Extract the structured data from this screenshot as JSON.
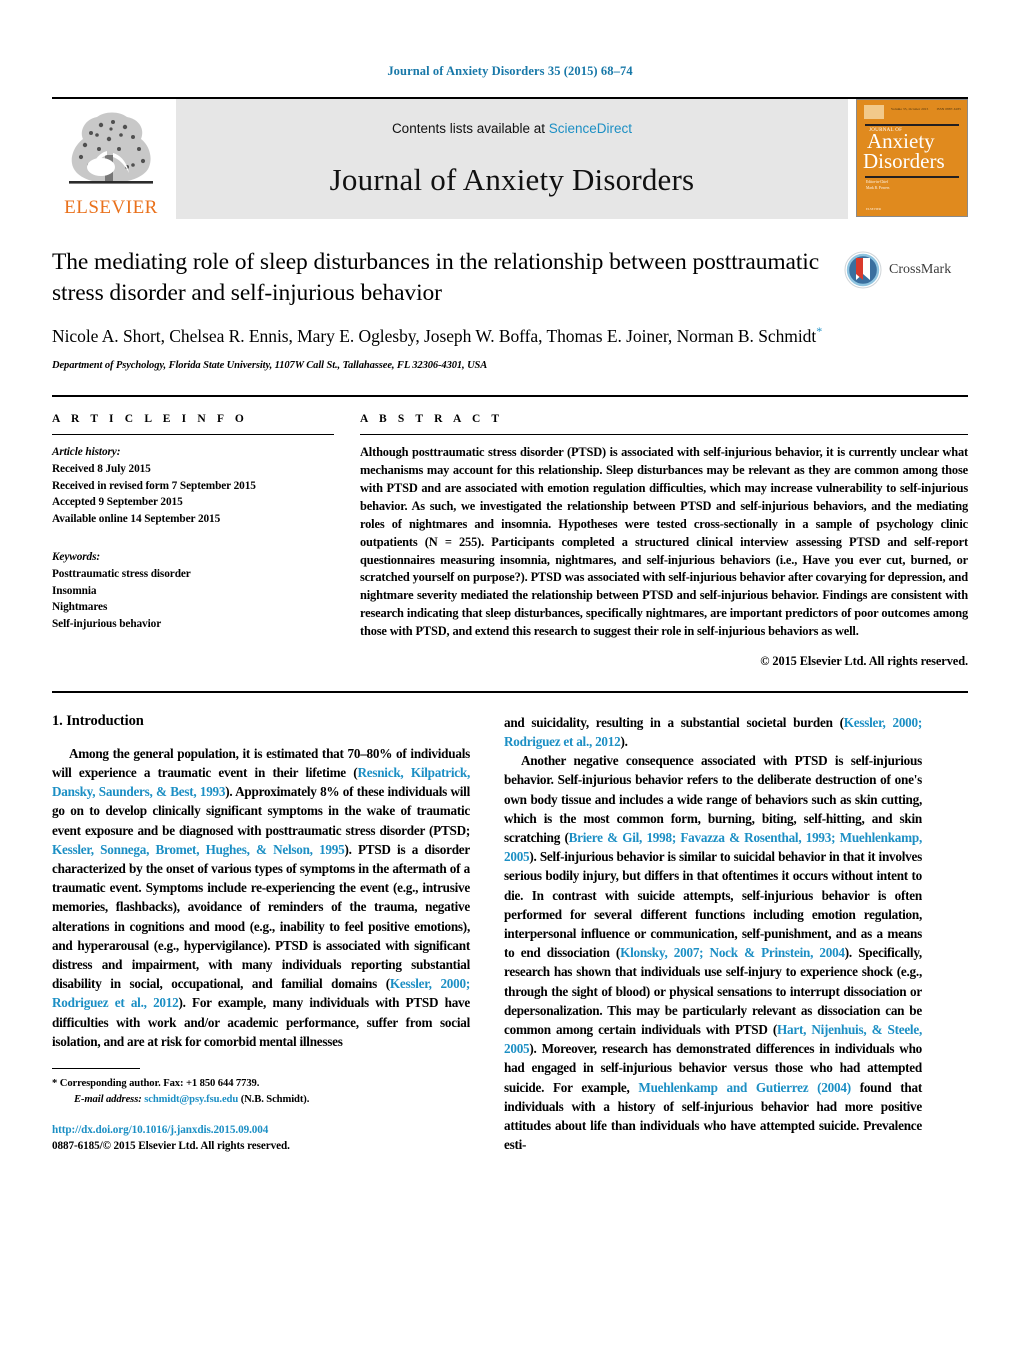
{
  "running_head": "Journal of Anxiety Disorders 35 (2015) 68–74",
  "masthead": {
    "elsevier_wordmark": "ELSEVIER",
    "contents_prefix": "Contents lists available at ",
    "sciencedirect": "ScienceDirect",
    "journal_name": "Journal of Anxiety Disorders",
    "cover": {
      "journal_of": "JOURNAL OF",
      "line1": "Anxiety",
      "line2": "Disorders",
      "editor_label": "Editor-in-Chief",
      "editor_name": "Mark B. Powers",
      "publisher": "ELSEVIER",
      "top_left": "ISSN",
      "top_mid": "Volume 35, October 2015",
      "top_right": "ISSN 0887-6185"
    },
    "link_color": "#1c8fc4",
    "cover_color": "#E08A1E",
    "elsevier_color": "#E9711C"
  },
  "title": "The mediating role of sleep disturbances in the relationship between posttraumatic stress disorder and self-injurious behavior",
  "authors": "Nicole A. Short, Chelsea R. Ennis, Mary E. Oglesby, Joseph W. Boffa, Thomas E. Joiner, Norman B. Schmidt",
  "corresponding_marker": "*",
  "affiliation": "Department of Psychology, Florida State University, 1107W Call St., Tallahassee, FL 32306-4301, USA",
  "crossmark": {
    "label": "CrossMark"
  },
  "article_info": {
    "heading": "A R T I C L E  I N F O",
    "history_label": "Article history:",
    "history": [
      "Received 8 July 2015",
      "Received in revised form 7 September 2015",
      "Accepted 9 September 2015",
      "Available online 14 September 2015"
    ],
    "keywords_label": "Keywords:",
    "keywords": [
      "Posttraumatic stress disorder",
      "Insomnia",
      "Nightmares",
      "Self-injurious behavior"
    ]
  },
  "abstract": {
    "heading": "A B S T R A C T",
    "text": "Although posttraumatic stress disorder (PTSD) is associated with self-injurious behavior, it is currently unclear what mechanisms may account for this relationship. Sleep disturbances may be relevant as they are common among those with PTSD and are associated with emotion regulation difficulties, which may increase vulnerability to self-injurious behavior. As such, we investigated the relationship between PTSD and self-injurious behaviors, and the mediating roles of nightmares and insomnia. Hypotheses were tested cross-sectionally in a sample of psychology clinic outpatients (N = 255). Participants completed a structured clinical interview assessing PTSD and self-report questionnaires measuring insomnia, nightmares, and self-injurious behaviors (i.e., Have you ever cut, burned, or scratched yourself on purpose?). PTSD was associated with self-injurious behavior after covarying for depression, and nightmare severity mediated the relationship between PTSD and self-injurious behavior. Findings are consistent with research indicating that sleep disturbances, specifically nightmares, are important predictors of poor outcomes among those with PTSD, and extend this research to suggest their role in self-injurious behaviors as well.",
    "copyright": "© 2015 Elsevier Ltd. All rights reserved."
  },
  "body": {
    "section_number_title": "1. Introduction",
    "left_paragraph_1": {
      "seg1": "Among the general population, it is estimated that 70–80% of individuals will experience a traumatic event in their lifetime (",
      "cite1": "Resnick, Kilpatrick, Dansky, Saunders, & Best, 1993",
      "seg2": "). Approximately 8% of these individuals will go on to develop clinically significant symptoms in the wake of traumatic event exposure and be diagnosed with posttraumatic stress disorder (PTSD; ",
      "cite2": "Kessler, Sonnega, Bromet, Hughes, & Nelson, 1995",
      "seg3": "). PTSD is a disorder characterized by the onset of various types of symptoms in the aftermath of a traumatic event. Symptoms include re-experiencing the event (e.g., intrusive memories, flashbacks), avoidance of reminders of the trauma, negative alterations in cognitions and mood (e.g., inability to feel positive emotions), and hyperarousal (e.g., hypervigilance). PTSD is associated with significant distress and impairment, with many individuals reporting substantial disability in social, occupational, and familial domains (",
      "cite3": "Kessler, 2000; Rodriguez et al., 2012",
      "seg4": "). For example, many individuals with PTSD have difficulties with work and/or academic performance, suffer from social isolation, and are at risk for comorbid mental illnesses"
    },
    "right_paragraph_1": {
      "seg1": "and suicidality, resulting in a substantial societal burden (",
      "cite1": "Kessler, 2000; Rodriguez et al., 2012",
      "seg2": ")."
    },
    "right_paragraph_2": {
      "seg1": "Another negative consequence associated with PTSD is self-injurious behavior. Self-injurious behavior refers to the deliberate destruction of one's own body tissue and includes a wide range of behaviors such as skin cutting, which is the most common form, burning, biting, self-hitting, and skin scratching (",
      "cite1": "Briere & Gil, 1998; Favazza & Rosenthal, 1993; Muehlenkamp, 2005",
      "seg2": "). Self-injurious behavior is similar to suicidal behavior in that it involves serious bodily injury, but differs in that oftentimes it occurs without intent to die. In contrast with suicide attempts, self-injurious behavior is often performed for several different functions including emotion regulation, interpersonal influence or communication, self-punishment, and as a means to end dissociation (",
      "cite2": "Klonsky, 2007; Nock & Prinstein, 2004",
      "seg3": "). Specifically, research has shown that individuals use self-injury to experience shock (e.g., through the sight of blood) or physical sensations to interrupt dissociation or depersonalization. This may be particularly relevant as dissociation can be common among certain individuals with PTSD (",
      "cite3": "Hart, Nijenhuis, & Steele, 2005",
      "seg4": "). Moreover, research has demonstrated differences in individuals who had engaged in self-injurious behavior versus those who had attempted suicide. For example, ",
      "cite4": "Muehlenkamp and Gutierrez (2004)",
      "seg5": " found that individuals with a history of self-injurious behavior had more positive attitudes about life than individuals who have attempted suicide. Prevalence esti-"
    }
  },
  "footnote": {
    "marker": "*",
    "corresponding": "Corresponding author. Fax: +1 850 644 7739.",
    "email_label": "E-mail address:",
    "email": "schmidt@psy.fsu.edu",
    "email_owner": "(N.B. Schmidt).",
    "doi_url": "http://dx.doi.org/10.1016/j.janxdis.2015.09.004",
    "issn_line": "0887-6185/© 2015 Elsevier Ltd. All rights reserved."
  }
}
